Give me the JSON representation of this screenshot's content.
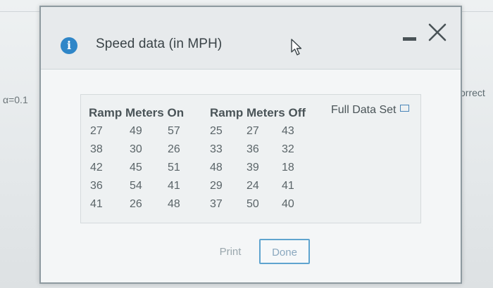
{
  "background": {
    "alpha_text": "α=0.1",
    "right_text": "correct"
  },
  "dialog": {
    "title": "Speed data (in MPH)",
    "icons": {
      "info": "info-icon",
      "cursor": "mouse-pointer-icon",
      "minimize": "minimize-icon",
      "close": "close-icon"
    },
    "full_data_link": "Full Data Set",
    "groups": [
      {
        "heading": "Ramp Meters On",
        "rows": [
          [
            "27",
            "49",
            "57"
          ],
          [
            "38",
            "30",
            "26"
          ],
          [
            "42",
            "45",
            "51"
          ],
          [
            "36",
            "54",
            "41"
          ],
          [
            "41",
            "26",
            "48"
          ]
        ]
      },
      {
        "heading": "Ramp Meters Off",
        "rows": [
          [
            "25",
            "27",
            "43"
          ],
          [
            "33",
            "36",
            "32"
          ],
          [
            "48",
            "39",
            "18"
          ],
          [
            "29",
            "24",
            "41"
          ],
          [
            "37",
            "50",
            "40"
          ]
        ]
      }
    ],
    "buttons": {
      "print": "Print",
      "done": "Done"
    },
    "colors": {
      "info_icon": "#2f86c8",
      "done_border": "#5fa4cf"
    }
  }
}
